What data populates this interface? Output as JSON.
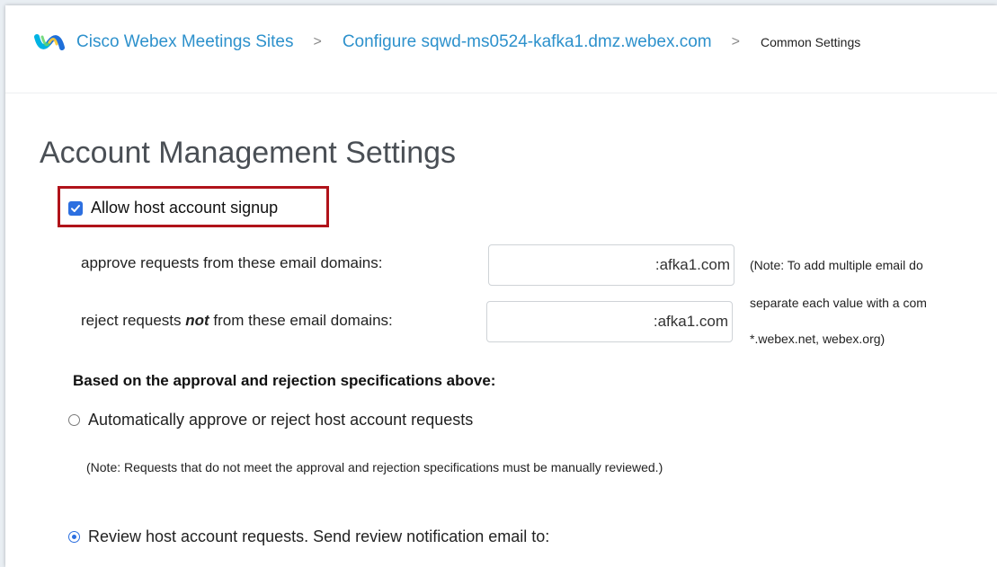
{
  "breadcrumb": {
    "root": "Cisco Webex Meetings Sites",
    "separator": ">",
    "site": "Configure sqwd-ms0524-kafka1.dmz.webex.com",
    "current": "Common Settings"
  },
  "page_title": "Account Management Settings",
  "signup": {
    "label": "Allow host account signup",
    "checked": true
  },
  "approve_domains": {
    "label": "approve requests from these email domains:",
    "value": ":afka1.com"
  },
  "reject_domains": {
    "label_before": "reject requests ",
    "label_emphasis": "not",
    "label_after": " from these email domains:",
    "value": ":afka1.com"
  },
  "domain_note": {
    "line1": "(Note: To add multiple email do",
    "line2": "separate each value with a com",
    "line3": "*.webex.net, webex.org)"
  },
  "approval_section": {
    "heading": "Based on the approval and rejection specifications above:",
    "option_auto": "Automatically approve or reject host account requests",
    "auto_note": "(Note: Requests that do not meet the approval and rejection specifications must be manually reviewed.)",
    "option_review": "Review host account requests. Send review notification email to:",
    "selected": "review"
  },
  "colors": {
    "link": "#2d91cc",
    "accent": "#2c6fe0",
    "highlight_border": "#b0131a"
  },
  "icons": {
    "logo": "webex-logo-icon",
    "checkbox": "checkmark-icon"
  }
}
